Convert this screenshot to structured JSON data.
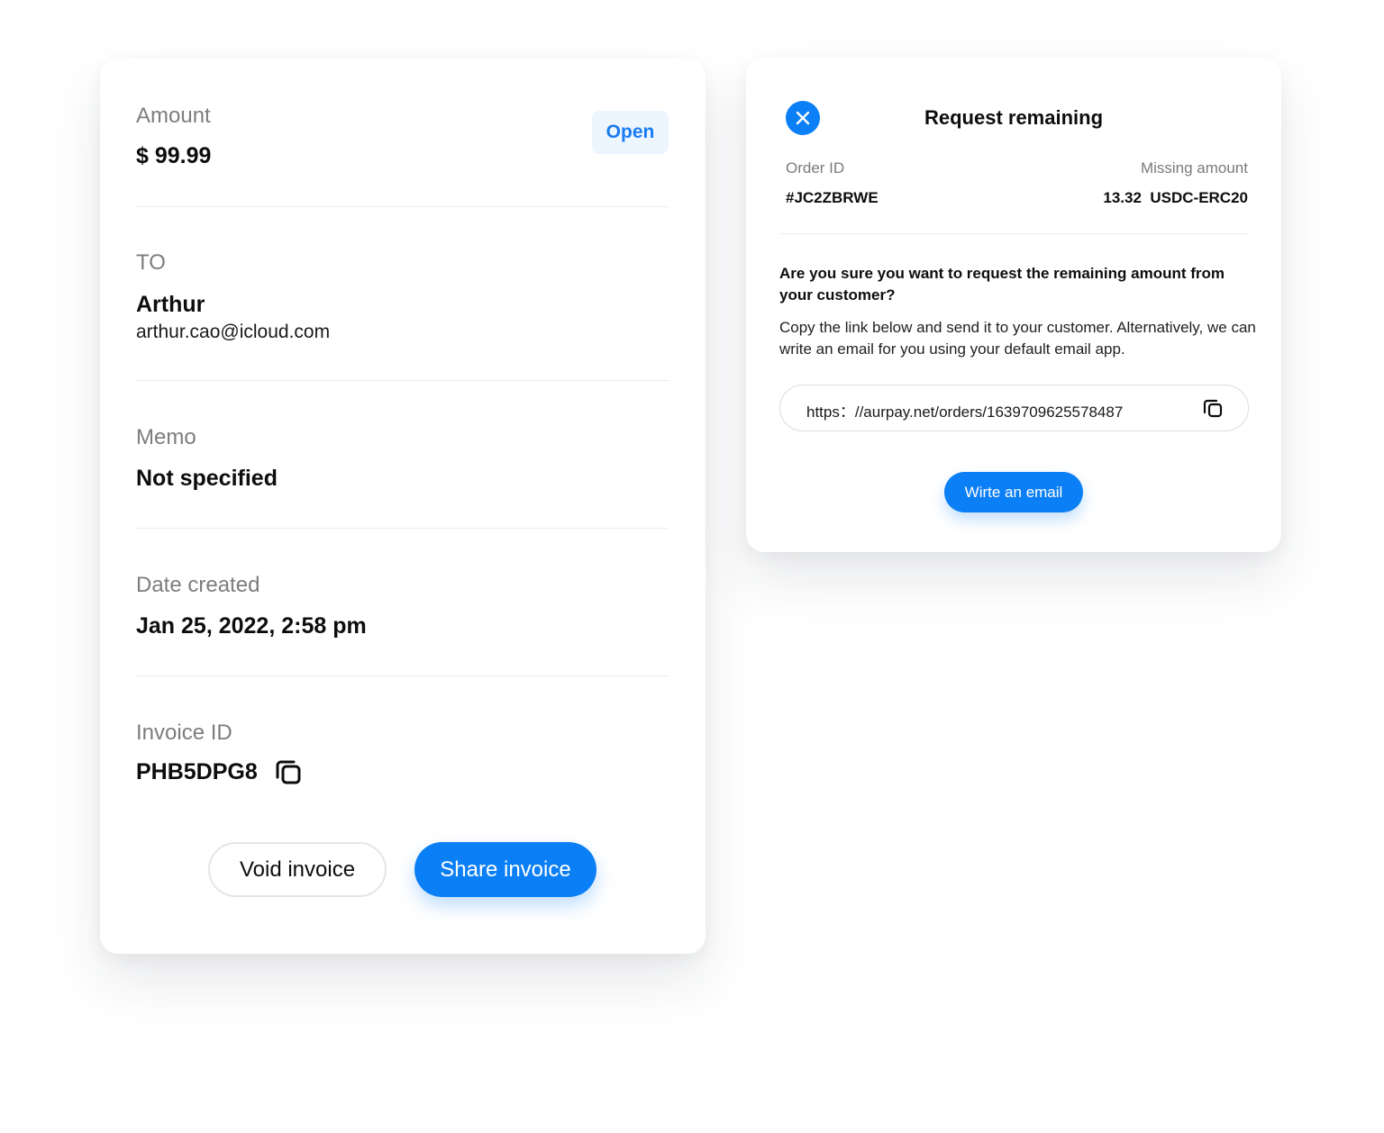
{
  "invoice": {
    "amount_label": "Amount",
    "amount_value": "$ 99.99",
    "status_badge": "Open",
    "to_label": "TO",
    "to_name": "Arthur",
    "to_email": "arthur.cao@icloud.com",
    "memo_label": "Memo",
    "memo_value": "Not specified",
    "date_label": "Date created",
    "date_value": "Jan 25, 2022, 2:58 pm",
    "invoice_id_label": "Invoice ID",
    "invoice_id_value": "PHB5DPG8",
    "void_button": "Void invoice",
    "share_button": "Share invoice"
  },
  "request_modal": {
    "title": "Request remaining",
    "order_id_label": "Order ID",
    "order_id_value": "#JC2ZBRWE",
    "missing_amount_label": "Missing amount",
    "missing_amount_value": "13.32  USDC-ERC20",
    "question": "Are you sure you want to request the remaining amount from your customer?",
    "description": "Copy the link below and send it to your customer. Alternatively, we can write an email for you using your default email app.",
    "link": "https：//aurpay.net/orders/1639709625578487",
    "email_button": "Wirte an email"
  },
  "colors": {
    "accent": "#0b7ff5",
    "badge_bg": "#edf5ff",
    "label_gray": "#7d7d7d"
  }
}
